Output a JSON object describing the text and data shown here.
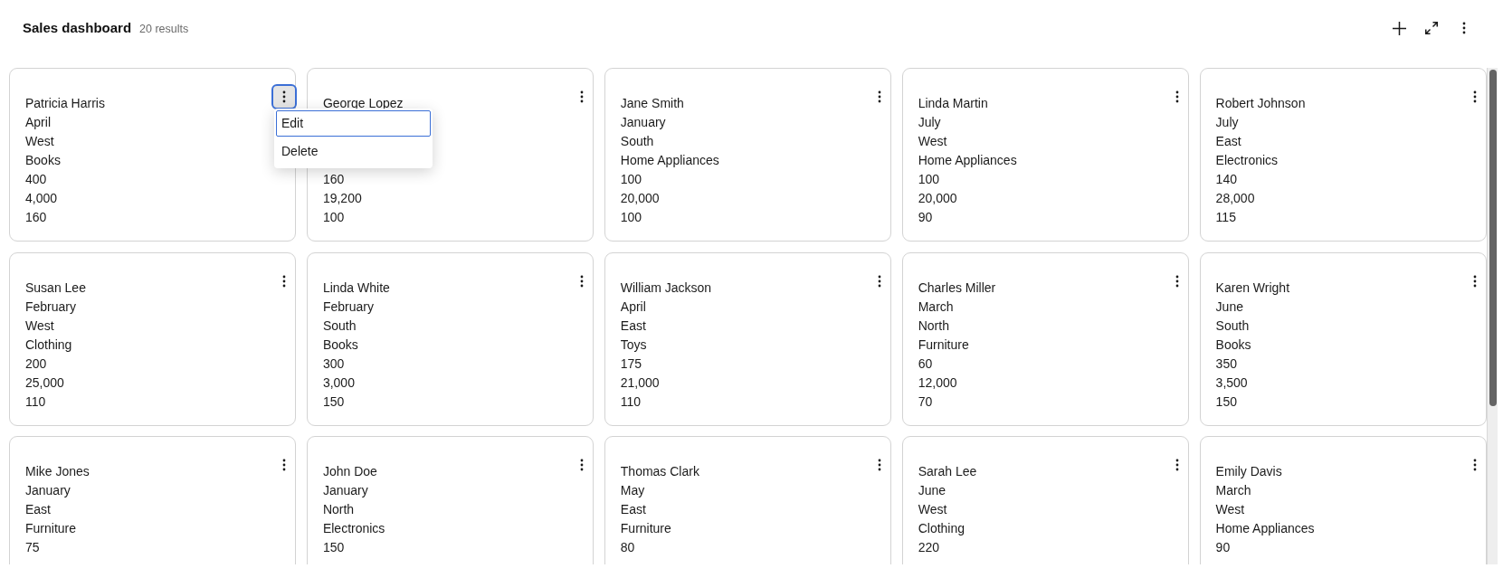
{
  "header": {
    "title": "Sales dashboard",
    "result_count": "20 results"
  },
  "cards": [
    {
      "name": "Patricia Harris",
      "month": "April",
      "region": "West",
      "category": "Books",
      "number_1": "400",
      "number_2": "4,000",
      "number_3": "160",
      "menu_open": true,
      "menu": {
        "items": [
          {
            "label": "Edit",
            "selected": true
          },
          {
            "label": "Delete",
            "selected": false
          }
        ]
      }
    },
    {
      "name": "George Lopez",
      "number_1": "160",
      "number_2": "19,200",
      "number_3": "100",
      "menu_open": false
    },
    {
      "name": "Jane Smith",
      "month": "January",
      "region": "South",
      "category": "Home Appliances",
      "number_1": "100",
      "number_2": "20,000",
      "number_3": "100",
      "menu_open": false
    },
    {
      "name": "Linda Martin",
      "month": "July",
      "region": "West",
      "category": "Home Appliances",
      "number_1": "100",
      "number_2": "20,000",
      "number_3": "90",
      "menu_open": false
    },
    {
      "name": "Robert Johnson",
      "month": "July",
      "region": "East",
      "category": "Electronics",
      "number_1": "140",
      "number_2": "28,000",
      "number_3": "115",
      "menu_open": false
    },
    {
      "name": "Susan Lee",
      "month": "February",
      "region": "West",
      "category": "Clothing",
      "number_1": "200",
      "number_2": "25,000",
      "number_3": "110",
      "menu_open": false
    },
    {
      "name": "Linda White",
      "month": "February",
      "region": "South",
      "category": "Books",
      "number_1": "300",
      "number_2": "3,000",
      "number_3": "150",
      "menu_open": false
    },
    {
      "name": "William Jackson",
      "month": "April",
      "region": "East",
      "category": "Toys",
      "number_1": "175",
      "number_2": "21,000",
      "number_3": "110",
      "menu_open": false
    },
    {
      "name": "Charles Miller",
      "month": "March",
      "region": "North",
      "category": "Furniture",
      "number_1": "60",
      "number_2": "12,000",
      "number_3": "70",
      "menu_open": false
    },
    {
      "name": "Karen Wright",
      "month": "June",
      "region": "South",
      "category": "Books",
      "number_1": "350",
      "number_2": "3,500",
      "number_3": "150",
      "menu_open": false
    },
    {
      "name": "Mike Jones",
      "month": "January",
      "region": "East",
      "category": "Furniture",
      "number_1": "75",
      "menu_open": false
    },
    {
      "name": "John Doe",
      "month": "January",
      "region": "North",
      "category": "Electronics",
      "number_1": "150",
      "menu_open": false
    },
    {
      "name": "Thomas Clark",
      "month": "May",
      "region": "East",
      "category": "Furniture",
      "number_1": "80",
      "menu_open": false
    },
    {
      "name": "Sarah Lee",
      "month": "June",
      "region": "West",
      "category": "Clothing",
      "number_1": "220",
      "menu_open": false
    },
    {
      "name": "Emily Davis",
      "month": "March",
      "region": "West",
      "category": "Home Appliances",
      "number_1": "90",
      "menu_open": false
    }
  ]
}
